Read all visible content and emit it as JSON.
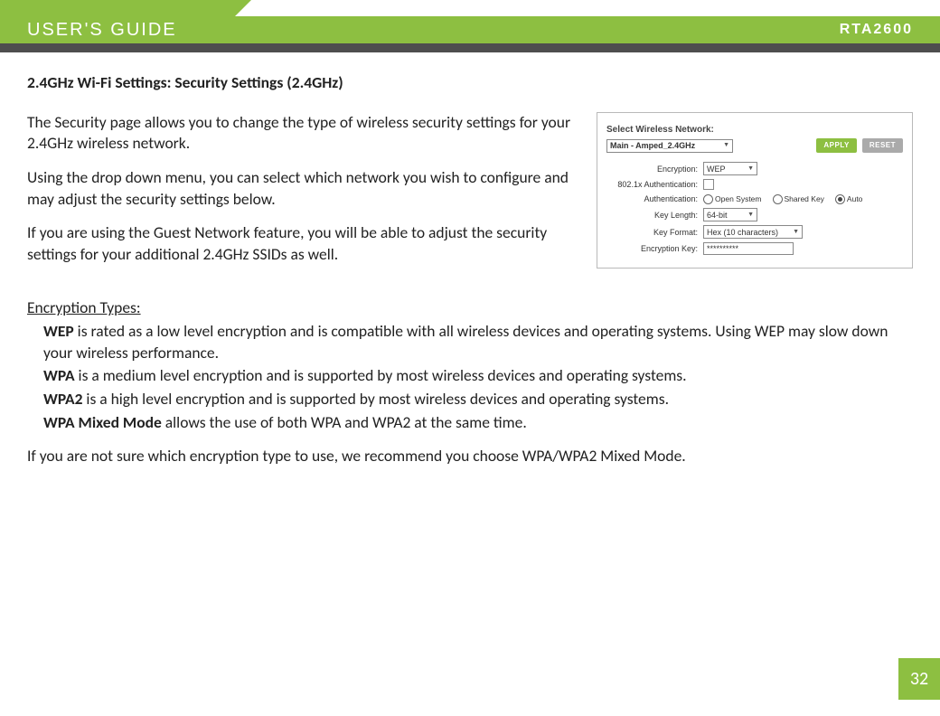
{
  "header": {
    "title": "USER'S GUIDE",
    "model": "RTA2600"
  },
  "section": {
    "heading": "2.4GHz Wi-Fi Settings: Security Settings (2.4GHz)",
    "p1": "The Security page allows you to change the type of wireless security settings for your 2.4GHz wireless network.",
    "p2": "Using the drop down menu, you can select which network you wish to configure and may adjust the security settings below.",
    "p3": "If you are using the Guest Network feature, you will be able to adjust the security settings for your additional 2.4GHz SSIDs as well."
  },
  "ui": {
    "select_label": "Select Wireless Network:",
    "network_value": "Main - Amped_2.4GHz",
    "apply": "APPLY",
    "reset": "RESET",
    "rows": {
      "encryption_label": "Encryption:",
      "encryption_value": "WEP",
      "x8021_label": "802.1x Authentication:",
      "auth_label": "Authentication:",
      "auth_open": "Open System",
      "auth_shared": "Shared Key",
      "auth_auto": "Auto",
      "keylen_label": "Key Length:",
      "keylen_value": "64-bit",
      "keyfmt_label": "Key Format:",
      "keyfmt_value": "Hex (10 characters)",
      "enckey_label": "Encryption Key:",
      "enckey_value": "**********"
    }
  },
  "encryption": {
    "title": "Encryption Types:",
    "wep_bold": "WEP",
    "wep_rest": " is rated as a low level encryption and is compatible with all wireless devices and operating systems. Using WEP may slow down your wireless performance.",
    "wpa_bold": "WPA",
    "wpa_rest": " is a medium level encryption and is supported by most wireless devices and operating systems.",
    "wpa2_bold": "WPA2",
    "wpa2_rest": " is a high level encryption and is supported by most wireless devices and operating systems.",
    "mix_bold": "WPA Mixed Mode",
    "mix_rest": " allows the use of both WPA and WPA2 at the same time.",
    "footer": "If you are not sure which encryption type to use, we recommend you choose WPA/WPA2 Mixed Mode."
  },
  "page_number": "32"
}
